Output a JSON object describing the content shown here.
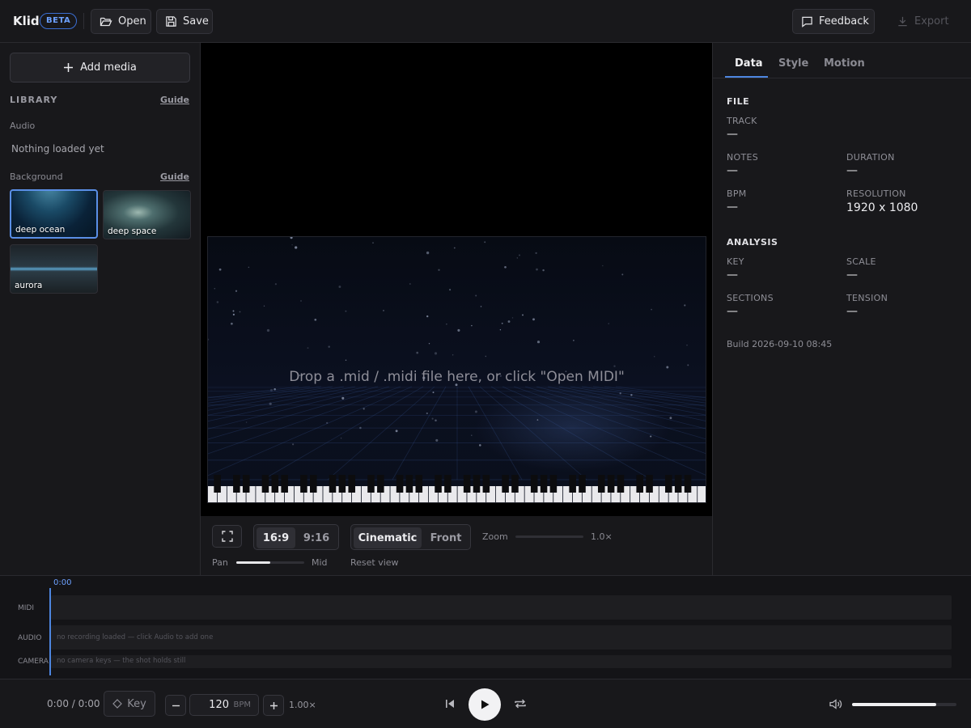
{
  "app": {
    "name": "Klid",
    "badge": "BETA"
  },
  "toolbar": {
    "open_label": "Open",
    "save_label": "Save",
    "feedback_label": "Feedback",
    "export_label": "Export"
  },
  "library": {
    "add_media_label": "Add media",
    "title": "LIBRARY",
    "guide_label": "Guide",
    "audio_title": "Audio",
    "audio_empty": "Nothing loaded yet",
    "background_title": "Background",
    "background_guide_label": "Guide",
    "backgrounds": [
      {
        "name": "deep ocean",
        "selected": true
      },
      {
        "name": "deep space",
        "selected": false
      },
      {
        "name": "aurora",
        "selected": false
      }
    ]
  },
  "stage": {
    "drop_message": "Drop a .mid / .midi file here, or click \"Open MIDI\"",
    "aspect_options": [
      "16:9",
      "9:16"
    ],
    "aspect_selected": "16:9",
    "view_options": [
      "Cinematic",
      "Front"
    ],
    "view_selected": "Cinematic",
    "zoom_label": "Zoom",
    "zoom_value": "1.0×",
    "zoom_level": 0.0,
    "pan_label": "Pan",
    "pan_value": "Mid",
    "pan_level": 0.5,
    "reset_label": "Reset view"
  },
  "inspector": {
    "tabs": [
      "Data",
      "Style",
      "Motion"
    ],
    "active_tab": "Data",
    "file_title": "FILE",
    "track_label": "TRACK",
    "track_value": "—",
    "notes_label": "NOTES",
    "notes_value": "—",
    "duration_label": "DURATION",
    "duration_value": "—",
    "bpm_label": "BPM",
    "bpm_value": "—",
    "resolution_label": "RESOLUTION",
    "resolution_value": "1920 x 1080",
    "analysis_title": "ANALYSIS",
    "key_label": "KEY",
    "key_value": "—",
    "scale_label": "SCALE",
    "scale_value": "—",
    "sections_label": "SECTIONS",
    "sections_value": "—",
    "tension_label": "TENSION",
    "tension_value": "—",
    "build": "Build 2026-09-10 08:45"
  },
  "timeline": {
    "playhead_time": "0:00",
    "tracks": [
      {
        "label": "MIDI",
        "hint": ""
      },
      {
        "label": "AUDIO",
        "hint": "no recording loaded — click Audio to add one"
      },
      {
        "label": "CAMERA",
        "hint": "no camera keys — the shot holds still"
      }
    ]
  },
  "transport": {
    "time": "0:00 / 0:00",
    "key_label": "Key",
    "bpm_value": "120",
    "bpm_unit": "BPM",
    "rate": "1.00×",
    "volume_level": 0.81
  },
  "colors": {
    "accent": "#4d86e0",
    "beta": "#6da1ff"
  }
}
